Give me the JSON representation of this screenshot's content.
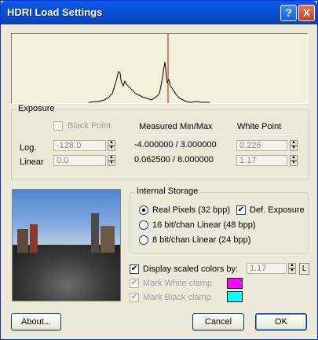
{
  "window": {
    "title": "HDRI Load Settings"
  },
  "titlebar_buttons": {
    "help": "?",
    "close": "X"
  },
  "histogram": {},
  "exposure": {
    "group_title": "Exposure",
    "black_point_label": "Black Point",
    "measured_header": "Measured Min/Max",
    "white_point_header": "White Point",
    "log_label": "Log.",
    "linear_label": "Linear",
    "log_black": "-128.0",
    "linear_black": "0.0",
    "log_measured": "-4.000000 / 3.000000",
    "linear_measured": "0.062500 / 8.000000",
    "log_white": "0.226",
    "linear_white": "1.17"
  },
  "internal_storage": {
    "group_title": "Internal Storage",
    "real_pixels": "Real Pixels (32 bpp)",
    "def_exposure": "Def. Exposure",
    "linear16": "16 bit/chan Linear (48 bpp)",
    "linear8": "8 bit/chan Linear (24 bpp)"
  },
  "display_scaled": {
    "label": "Display scaled colors by:",
    "value": "1.17",
    "l_button": "L"
  },
  "clamps": {
    "white_label": "Mark White clamp",
    "black_label": "Mark Black clamp",
    "white_color": "#ff00ff",
    "black_color": "#00ffff"
  },
  "buttons": {
    "about": "About...",
    "cancel": "Cancel",
    "ok": "OK"
  }
}
